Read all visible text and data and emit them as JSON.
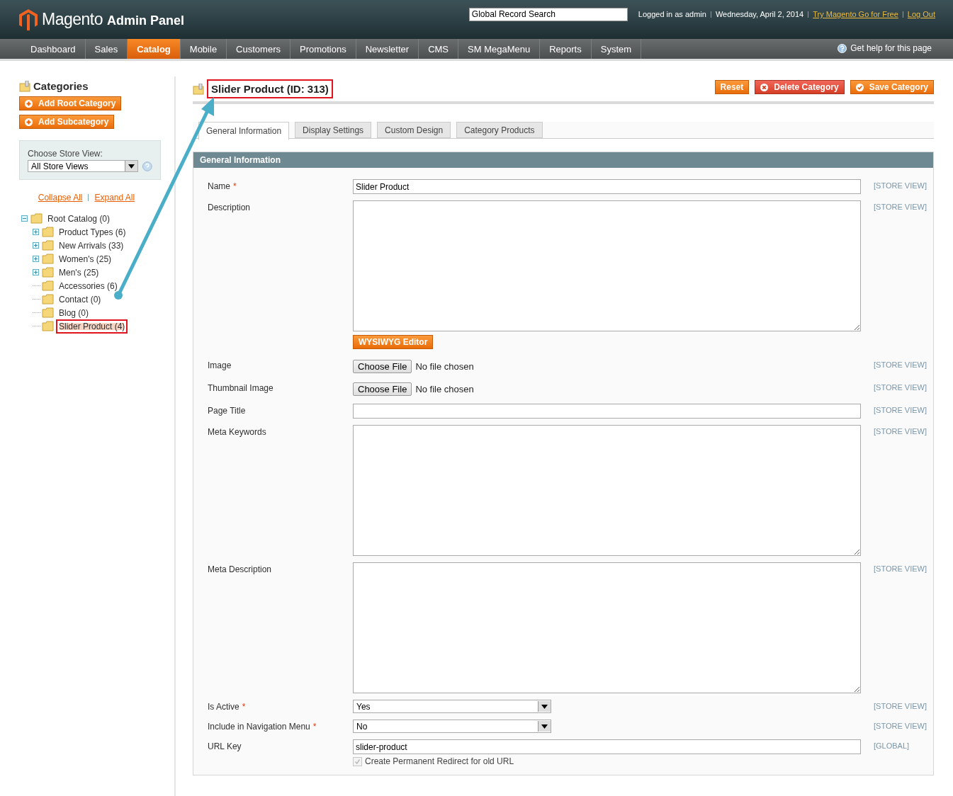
{
  "header": {
    "logo": "Magento",
    "logo_suffix": "Admin Panel",
    "search": {
      "placeholder": "Global Record Search"
    },
    "user": "Logged in as admin",
    "date": "Wednesday, April 2, 2014",
    "links": [
      "Try Magento Go for Free",
      "Log Out"
    ]
  },
  "nav": {
    "items": [
      {
        "label": "Dashboard",
        "selected": false
      },
      {
        "label": "Sales",
        "selected": false
      },
      {
        "label": "Catalog",
        "selected": true
      },
      {
        "label": "Mobile",
        "selected": false
      },
      {
        "label": "Customers",
        "selected": false
      },
      {
        "label": "Promotions",
        "selected": false
      },
      {
        "label": "Newsletter",
        "selected": false
      },
      {
        "label": "CMS",
        "selected": false
      },
      {
        "label": "SM MegaMenu",
        "selected": false
      },
      {
        "label": "Reports",
        "selected": false
      },
      {
        "label": "System",
        "selected": false
      }
    ],
    "help": "Get help for this page"
  },
  "sidebar": {
    "title": "Categories",
    "buttons": [
      "Add Root Category",
      "Add Subcategory"
    ],
    "store_view": {
      "label": "Choose Store View:",
      "value": "All Store Views"
    },
    "links": [
      "Collapse All",
      "Expand All"
    ],
    "tree": [
      {
        "label": "Root Catalog (0)",
        "expanded": true,
        "selected": false,
        "highlighted": false,
        "children": [
          {
            "label": "Product Types (6)",
            "expanded": false,
            "selected": false,
            "highlighted": false
          },
          {
            "label": "New Arrivals (33)",
            "expanded": false,
            "selected": false,
            "highlighted": false
          },
          {
            "label": "Women's (25)",
            "expanded": false,
            "selected": false,
            "highlighted": false
          },
          {
            "label": "Men's (25)",
            "expanded": false,
            "selected": false,
            "highlighted": false
          },
          {
            "label": "Accessories (6)",
            "selected": false,
            "highlighted": false
          },
          {
            "label": "Contact (0)",
            "selected": false,
            "highlighted": false
          },
          {
            "label": "Blog (0)",
            "selected": false,
            "highlighted": false
          },
          {
            "label": "Slider Product (4)",
            "selected": true,
            "highlighted": true
          }
        ]
      }
    ]
  },
  "main": {
    "title": "Slider Product (ID: 313)",
    "title_highlighted": true,
    "buttons": [
      {
        "label": "Reset",
        "kind": "plain"
      },
      {
        "label": "Delete Category",
        "kind": "delete"
      },
      {
        "label": "Save Category",
        "kind": "save"
      }
    ],
    "tabs": [
      {
        "label": "General Information",
        "selected": true
      },
      {
        "label": "Display Settings",
        "selected": false
      },
      {
        "label": "Custom Design",
        "selected": false
      },
      {
        "label": "Category Products",
        "selected": false
      }
    ],
    "section": "General Information",
    "fields": [
      {
        "label": "Name",
        "required_mark": "*",
        "kind": "text",
        "value": "Slider Product",
        "scope": "[STORE VIEW]"
      },
      {
        "label": "Description",
        "kind": "textarea",
        "button": "WYSIWYG Editor",
        "scope": "[STORE VIEW]"
      },
      {
        "label": "Image",
        "kind": "file",
        "button": "Choose File",
        "status": "No file chosen",
        "scope": "[STORE VIEW]"
      },
      {
        "label": "Thumbnail Image",
        "kind": "file",
        "button": "Choose File",
        "status": "No file chosen",
        "scope": "[STORE VIEW]"
      },
      {
        "label": "Page Title",
        "kind": "text",
        "scope": "[STORE VIEW]"
      },
      {
        "label": "Meta Keywords",
        "kind": "textarea",
        "scope": "[STORE VIEW]"
      },
      {
        "label": "Meta Description",
        "kind": "textarea",
        "scope": "[STORE VIEW]"
      },
      {
        "label": "Is Active",
        "required_mark": "*",
        "kind": "select",
        "value": "Yes",
        "scope": "[STORE VIEW]"
      },
      {
        "label": "Include in Navigation Menu",
        "required_mark": "*",
        "kind": "select",
        "value": "No",
        "scope": "[STORE VIEW]"
      },
      {
        "label": "URL Key",
        "kind": "text",
        "value": "slider-product",
        "scope": "[GLOBAL]",
        "checkbox": {
          "label": "Create Permanent Redirect for old URL",
          "checked": true,
          "disabled": true
        }
      }
    ]
  }
}
